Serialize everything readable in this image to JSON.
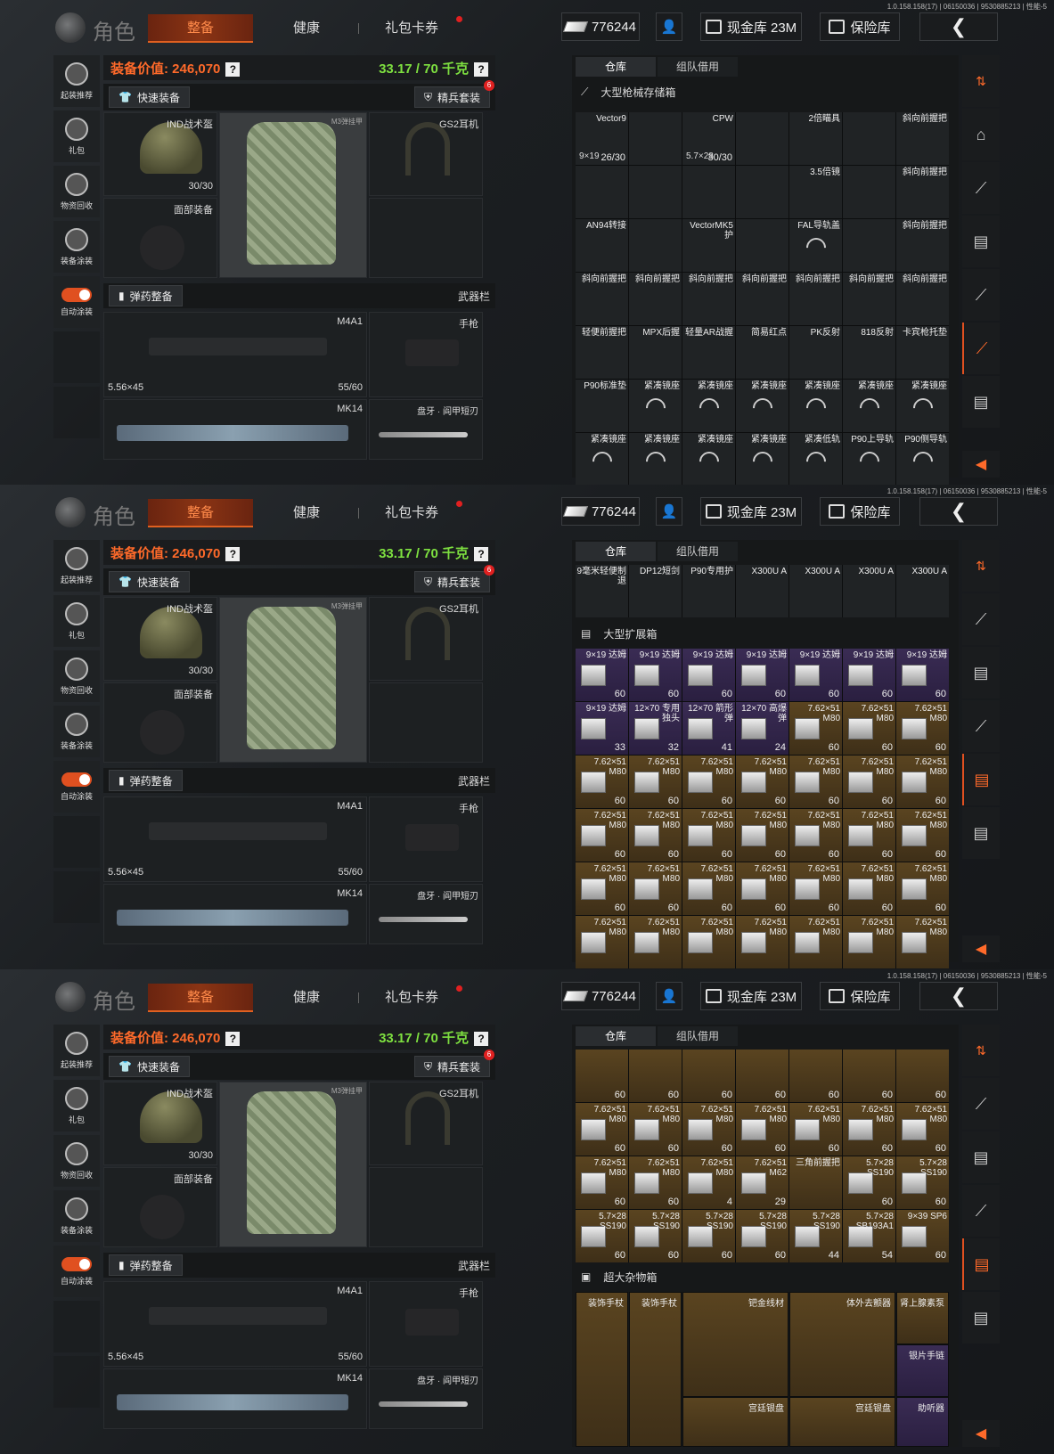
{
  "version": "1.0.158.158(17) | 06150036 | 9530885213 | 性能-5",
  "title": "角色",
  "tabs": [
    {
      "label": "整备"
    },
    {
      "label": "健康"
    },
    {
      "label": "礼包卡券"
    }
  ],
  "currency": {
    "amount": "776244"
  },
  "cash_vault": {
    "label": "现金库 23M"
  },
  "safe_box": {
    "label": "保险库"
  },
  "sidebar": [
    {
      "label": "起装推荐"
    },
    {
      "label": "礼包"
    },
    {
      "label": "物资回收"
    },
    {
      "label": "装备涂装"
    },
    {
      "label": "自动涂装"
    }
  ],
  "equip": {
    "value_label": "装备价值: 246,070",
    "weight_label": "33.17 / 70 千克",
    "quick_btn": "快速装备",
    "elite_btn": "精兵套装",
    "elite_badge": "6",
    "helmet": {
      "name": "IND战术盔",
      "dur": "30/30"
    },
    "armor": {
      "name": "M3弹挂甲"
    },
    "headset": {
      "name": "GS2耳机"
    },
    "face": {
      "name": "面部装备"
    },
    "ammo_btn": "弹药整备",
    "weapon_bar": "武器栏",
    "primary": {
      "name": "M4A1",
      "ammo": "5.56×45",
      "count": "55/60"
    },
    "pistol": {
      "name": "手枪"
    },
    "secondary": {
      "name": "MK14"
    },
    "melee": {
      "name": "盘牙 · 阎甲短刃"
    }
  },
  "storage_tabs": [
    {
      "label": "仓库"
    },
    {
      "label": "组队借用"
    }
  ],
  "screen1": {
    "box_title": "大型枪械存储箱",
    "cells": [
      {
        "n": "Vector9",
        "c": "26/30",
        "a": "9×19"
      },
      {
        "n": "",
        "c": ""
      },
      {
        "n": "CPW",
        "c": "30/30",
        "a": "5.7×28"
      },
      {
        "n": "",
        "c": ""
      },
      {
        "n": "2倍瞄具",
        "c": ""
      },
      {
        "n": "",
        "c": ""
      },
      {
        "n": "斜向前握把",
        "c": ""
      },
      {
        "n": "",
        "c": ""
      },
      {
        "n": "",
        "c": ""
      },
      {
        "n": "",
        "c": ""
      },
      {
        "n": "",
        "c": ""
      },
      {
        "n": "3.5倍镜",
        "c": ""
      },
      {
        "n": "",
        "c": ""
      },
      {
        "n": "斜向前握把",
        "c": ""
      },
      {
        "n": "AN94转接",
        "c": ""
      },
      {
        "n": "",
        "c": ""
      },
      {
        "n": "VectorMK5护",
        "c": ""
      },
      {
        "n": "",
        "c": ""
      },
      {
        "n": "FAL导轨盖",
        "c": ""
      },
      {
        "n": "",
        "c": ""
      },
      {
        "n": "斜向前握把",
        "c": ""
      },
      {
        "n": "斜向前握把",
        "c": ""
      },
      {
        "n": "斜向前握把",
        "c": ""
      },
      {
        "n": "斜向前握把",
        "c": ""
      },
      {
        "n": "斜向前握把",
        "c": ""
      },
      {
        "n": "斜向前握把",
        "c": ""
      },
      {
        "n": "斜向前握把",
        "c": ""
      },
      {
        "n": "斜向前握把",
        "c": ""
      },
      {
        "n": "轻便前握把",
        "c": ""
      },
      {
        "n": "MPX后握",
        "c": ""
      },
      {
        "n": "轻量AR战握",
        "c": ""
      },
      {
        "n": "简易红点",
        "c": ""
      },
      {
        "n": "PK反射",
        "c": ""
      },
      {
        "n": "818反射",
        "c": ""
      },
      {
        "n": "卡宾枪托垫",
        "c": ""
      },
      {
        "n": "P90标准垫",
        "c": ""
      },
      {
        "n": "紧凑镜座",
        "c": ""
      },
      {
        "n": "紧凑镜座",
        "c": ""
      },
      {
        "n": "紧凑镜座",
        "c": ""
      },
      {
        "n": "紧凑镜座",
        "c": ""
      },
      {
        "n": "紧凑镜座",
        "c": ""
      },
      {
        "n": "紧凑镜座",
        "c": ""
      },
      {
        "n": "紧凑镜座",
        "c": ""
      },
      {
        "n": "紧凑镜座",
        "c": ""
      },
      {
        "n": "紧凑镜座",
        "c": ""
      },
      {
        "n": "紧凑镜座",
        "c": ""
      },
      {
        "n": "紧凑低轨",
        "c": ""
      },
      {
        "n": "P90上导轨",
        "c": ""
      },
      {
        "n": "P90侧导轨",
        "c": ""
      }
    ]
  },
  "screen2": {
    "top_row": [
      {
        "n": "9毫米轻便制退"
      },
      {
        "n": "DP12短剑"
      },
      {
        "n": "P90专用护"
      },
      {
        "n": "X300U A"
      },
      {
        "n": "X300U A"
      },
      {
        "n": "X300U A"
      },
      {
        "n": "X300U A"
      }
    ],
    "box_title": "大型扩展箱",
    "rows": [
      [
        {
          "n": "9×19 达姆",
          "c": "60",
          "t": "p"
        },
        {
          "n": "9×19 达姆",
          "c": "60",
          "t": "p"
        },
        {
          "n": "9×19 达姆",
          "c": "60",
          "t": "p"
        },
        {
          "n": "9×19 达姆",
          "c": "60",
          "t": "p"
        },
        {
          "n": "9×19 达姆",
          "c": "60",
          "t": "p"
        },
        {
          "n": "9×19 达姆",
          "c": "60",
          "t": "p"
        },
        {
          "n": "9×19 达姆",
          "c": "60",
          "t": "p"
        }
      ],
      [
        {
          "n": "9×19 达姆",
          "c": "33",
          "t": "p"
        },
        {
          "n": "12×70 专用独头",
          "c": "32",
          "t": "p"
        },
        {
          "n": "12×70 箭形弹",
          "c": "41",
          "t": "p"
        },
        {
          "n": "12×70 高爆弹",
          "c": "24",
          "t": "p"
        },
        {
          "n": "7.62×51 M80",
          "c": "60",
          "t": "a"
        },
        {
          "n": "7.62×51 M80",
          "c": "60",
          "t": "a"
        },
        {
          "n": "7.62×51 M80",
          "c": "60",
          "t": "a"
        }
      ],
      [
        {
          "n": "7.62×51 M80",
          "c": "60",
          "t": "a"
        },
        {
          "n": "7.62×51 M80",
          "c": "60",
          "t": "a"
        },
        {
          "n": "7.62×51 M80",
          "c": "60",
          "t": "a"
        },
        {
          "n": "7.62×51 M80",
          "c": "60",
          "t": "a"
        },
        {
          "n": "7.62×51 M80",
          "c": "60",
          "t": "a"
        },
        {
          "n": "7.62×51 M80",
          "c": "60",
          "t": "a"
        },
        {
          "n": "7.62×51 M80",
          "c": "60",
          "t": "a"
        }
      ],
      [
        {
          "n": "7.62×51 M80",
          "c": "60",
          "t": "a"
        },
        {
          "n": "7.62×51 M80",
          "c": "60",
          "t": "a"
        },
        {
          "n": "7.62×51 M80",
          "c": "60",
          "t": "a"
        },
        {
          "n": "7.62×51 M80",
          "c": "60",
          "t": "a"
        },
        {
          "n": "7.62×51 M80",
          "c": "60",
          "t": "a"
        },
        {
          "n": "7.62×51 M80",
          "c": "60",
          "t": "a"
        },
        {
          "n": "7.62×51 M80",
          "c": "60",
          "t": "a"
        }
      ],
      [
        {
          "n": "7.62×51 M80",
          "c": "60",
          "t": "a"
        },
        {
          "n": "7.62×51 M80",
          "c": "60",
          "t": "a"
        },
        {
          "n": "7.62×51 M80",
          "c": "60",
          "t": "a"
        },
        {
          "n": "7.62×51 M80",
          "c": "60",
          "t": "a"
        },
        {
          "n": "7.62×51 M80",
          "c": "60",
          "t": "a"
        },
        {
          "n": "7.62×51 M80",
          "c": "60",
          "t": "a"
        },
        {
          "n": "7.62×51 M80",
          "c": "60",
          "t": "a"
        }
      ],
      [
        {
          "n": "7.62×51 M80",
          "c": "",
          "t": "a"
        },
        {
          "n": "7.62×51 M80",
          "c": "",
          "t": "a"
        },
        {
          "n": "7.62×51 M80",
          "c": "",
          "t": "a"
        },
        {
          "n": "7.62×51 M80",
          "c": "",
          "t": "a"
        },
        {
          "n": "7.62×51 M80",
          "c": "",
          "t": "a"
        },
        {
          "n": "7.62×51 M80",
          "c": "",
          "t": "a"
        },
        {
          "n": "7.62×51 M80",
          "c": "",
          "t": "a"
        }
      ]
    ]
  },
  "screen3": {
    "rows": [
      [
        {
          "n": "",
          "c": "60",
          "t": "a"
        },
        {
          "n": "",
          "c": "60",
          "t": "a"
        },
        {
          "n": "",
          "c": "60",
          "t": "a"
        },
        {
          "n": "",
          "c": "60",
          "t": "a"
        },
        {
          "n": "",
          "c": "60",
          "t": "a"
        },
        {
          "n": "",
          "c": "60",
          "t": "a"
        },
        {
          "n": "",
          "c": "60",
          "t": "a"
        }
      ],
      [
        {
          "n": "7.62×51 M80",
          "c": "60",
          "t": "a"
        },
        {
          "n": "7.62×51 M80",
          "c": "60",
          "t": "a"
        },
        {
          "n": "7.62×51 M80",
          "c": "60",
          "t": "a"
        },
        {
          "n": "7.62×51 M80",
          "c": "60",
          "t": "a"
        },
        {
          "n": "7.62×51 M80",
          "c": "60",
          "t": "a"
        },
        {
          "n": "7.62×51 M80",
          "c": "60",
          "t": "a"
        },
        {
          "n": "7.62×51 M80",
          "c": "60",
          "t": "a"
        }
      ],
      [
        {
          "n": "7.62×51 M80",
          "c": "60",
          "t": "a"
        },
        {
          "n": "7.62×51 M80",
          "c": "60",
          "t": "a"
        },
        {
          "n": "7.62×51 M80",
          "c": "4",
          "t": "a"
        },
        {
          "n": "7.62×51 M62",
          "c": "29",
          "t": "a"
        },
        {
          "n": "三角前握把",
          "c": "",
          "t": "a"
        },
        {
          "n": "5.7×28 SS190",
          "c": "60",
          "t": "a"
        },
        {
          "n": "5.7×28 SS190",
          "c": "60",
          "t": "a"
        }
      ],
      [
        {
          "n": "5.7×28 SS190",
          "c": "60",
          "t": "a"
        },
        {
          "n": "5.7×28 SS190",
          "c": "60",
          "t": "a"
        },
        {
          "n": "5.7×28 SS190",
          "c": "60",
          "t": "a"
        },
        {
          "n": "5.7×28 SS190",
          "c": "60",
          "t": "a"
        },
        {
          "n": "5.7×28 SS190",
          "c": "44",
          "t": "a"
        },
        {
          "n": "5.7×28 SB193A1",
          "c": "54",
          "t": "a"
        },
        {
          "n": "9×39 SP6",
          "c": "60",
          "t": "a"
        }
      ]
    ],
    "box_title": "超大杂物箱",
    "items": [
      {
        "n": "装饰手杖"
      },
      {
        "n": "装饰手杖"
      },
      {
        "n": "钯金线材"
      },
      {
        "n": "体外去颤器"
      },
      {
        "n": "肾上腺素泵"
      },
      {
        "n": "银片手链"
      },
      {
        "n": "助听器"
      },
      {
        "n": "宫廷银盘"
      },
      {
        "n": "宫廷银盘"
      }
    ]
  }
}
